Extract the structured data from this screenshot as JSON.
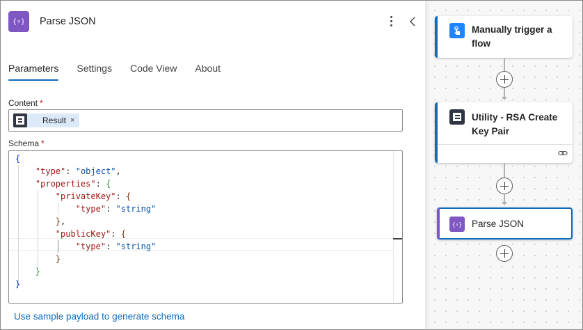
{
  "panel": {
    "title": "Parse JSON",
    "icon_text": "{▿}",
    "tabs": [
      {
        "label": "Parameters",
        "active": true
      },
      {
        "label": "Settings",
        "active": false
      },
      {
        "label": "Code View",
        "active": false
      },
      {
        "label": "About",
        "active": false
      }
    ],
    "content": {
      "label": "Content",
      "required_mark": "*",
      "token": {
        "label": "Result",
        "remove": "×"
      }
    },
    "schema": {
      "label": "Schema",
      "required_mark": "*"
    },
    "sample_link": "Use sample payload to generate schema"
  },
  "canvas": {
    "nodes": [
      {
        "title": "Manually trigger a flow",
        "icon": "touch-icon",
        "accent": "#1f85ff"
      },
      {
        "title": "Utility - RSA Create Key Pair",
        "icon": "utility-icon",
        "accent": "#0f6cbd"
      },
      {
        "title": "Parse JSON",
        "icon": "parse-json-icon",
        "icon_text": "{▿}",
        "accent": "#7e57c2"
      }
    ]
  },
  "colors": {
    "accent": "#0f6cbd",
    "parse_json": "#7e57c2",
    "required": "#c50f1f"
  }
}
